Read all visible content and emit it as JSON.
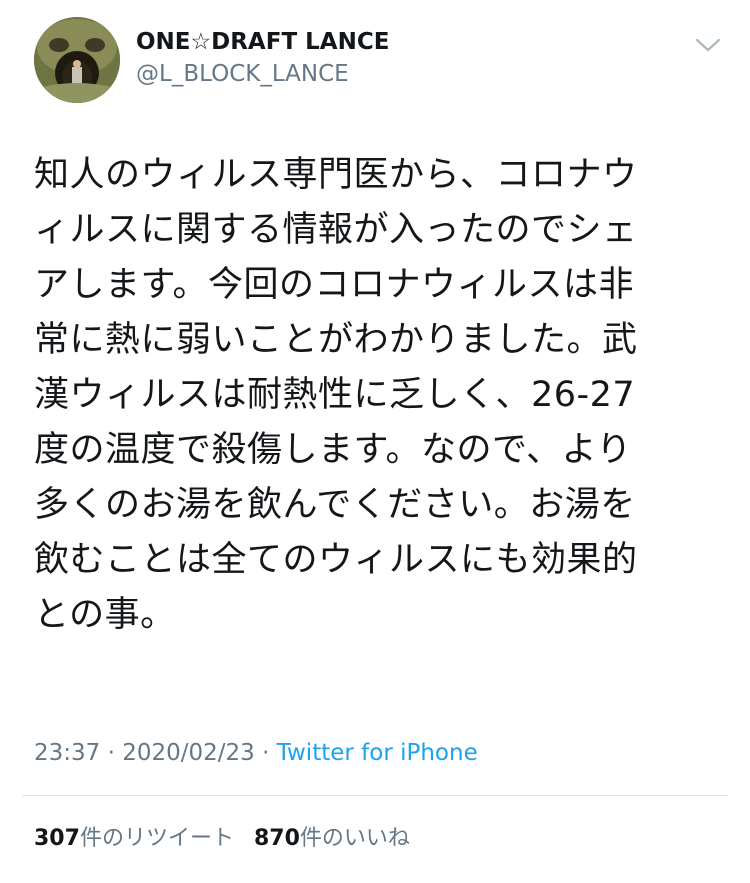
{
  "user": {
    "display_name": "ONE☆DRAFT LANCE",
    "handle": "@L_BLOCK_LANCE",
    "avatar_icon": "avatar-photo-stone-face"
  },
  "menu_icon": "chevron-down-icon",
  "tweet": {
    "lines": [
      "知人のウィルス専門医から、コロナウ",
      "ィルスに関する情報が入ったのでシェ",
      "アします。今回のコロナウィルスは非",
      "常に熱に弱いことがわかりました。武",
      "漢ウィルスは耐熱性に乏しく、26-27",
      "度の温度で殺傷します。なので、より",
      "多くのお湯を飲んでください。お湯を",
      "飲むことは全てのウィルスにも効果的",
      "との事。"
    ]
  },
  "meta": {
    "time": "23:37",
    "separator": " · ",
    "date": "2020/02/23",
    "source": "Twitter for iPhone"
  },
  "stats": {
    "retweets_count": "307",
    "retweets_label": "件のリツイート",
    "likes_count": "870",
    "likes_label": "件のいいね"
  },
  "colors": {
    "text": "#14171a",
    "secondary": "#657786",
    "link": "#1da1f2",
    "divider": "#e1e8ed"
  }
}
